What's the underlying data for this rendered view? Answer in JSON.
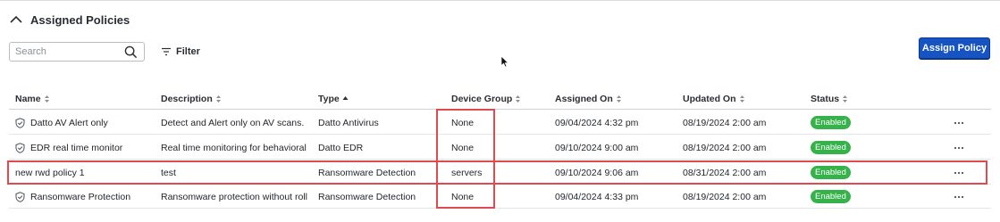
{
  "section": {
    "title": "Assigned Policies"
  },
  "toolbar": {
    "search_placeholder": "Search",
    "filter_label": "Filter",
    "assign_label": "Assign Policy"
  },
  "columns": [
    "Name",
    "Description",
    "Type",
    "Device Group",
    "Assigned On",
    "Updated On",
    "Status"
  ],
  "rows": [
    {
      "name": "Datto AV Alert only",
      "description": "Detect and Alert only on AV scans. Us",
      "type": "Datto Antivirus",
      "device_group": "None",
      "assigned_on": "09/04/2024 4:32 pm",
      "updated_on": "08/19/2024 2:00 am",
      "status": "Enabled",
      "shield": true
    },
    {
      "name": "EDR real time monitor",
      "description": "Real time monitoring for behavioral de",
      "type": "Datto EDR",
      "device_group": "None",
      "assigned_on": "09/10/2024 9:00 am",
      "updated_on": "08/19/2024 2:00 am",
      "status": "Enabled",
      "shield": true
    },
    {
      "name": "new rwd policy 1",
      "description": "test",
      "type": "Ransomware Detection",
      "device_group": "servers",
      "assigned_on": "09/10/2024 9:06 am",
      "updated_on": "08/31/2024 2:00 am",
      "status": "Enabled",
      "shield": false
    },
    {
      "name": "Ransomware Protection",
      "description": "Ransomware protection without rollba",
      "type": "Ransomware Detection",
      "device_group": "None",
      "assigned_on": "09/04/2024 4:33 pm",
      "updated_on": "08/19/2024 2:00 am",
      "status": "Enabled",
      "shield": true
    }
  ],
  "colors": {
    "primary": "#1554c2",
    "status_enabled": "#35b24a",
    "highlight": "#e04a4f"
  }
}
